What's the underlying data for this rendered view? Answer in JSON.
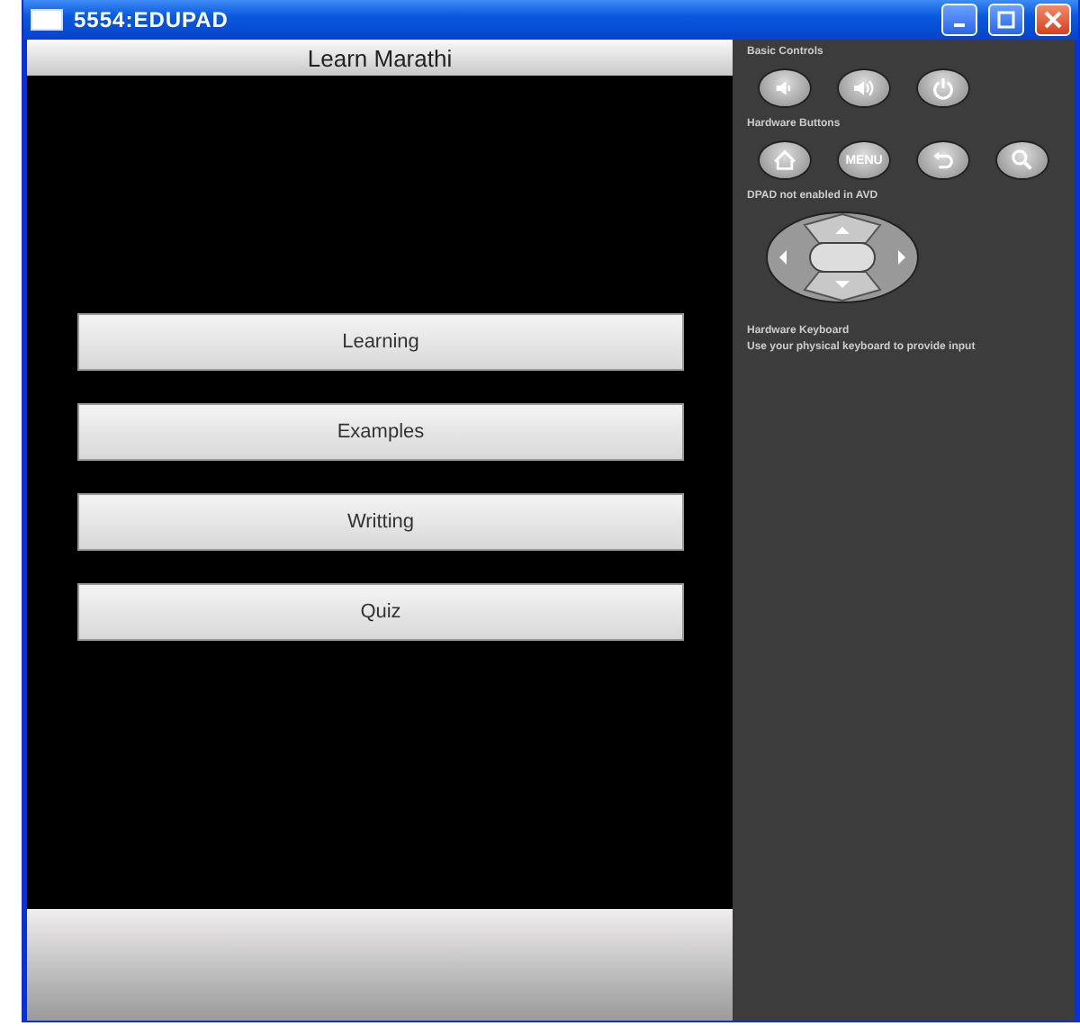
{
  "window": {
    "title": "5554:EDUPAD"
  },
  "app": {
    "title": "Learn Marathi",
    "buttons": [
      "Learning",
      "Examples",
      "Writting",
      "Quiz"
    ]
  },
  "controls": {
    "basic_title": "Basic Controls",
    "basic_buttons": [
      {
        "kind": "volume-down"
      },
      {
        "kind": "volume-up"
      },
      {
        "kind": "power"
      }
    ],
    "hardware_title": "Hardware Buttons",
    "hardware_buttons": [
      {
        "kind": "home"
      },
      {
        "kind": "menu",
        "label": "MENU"
      },
      {
        "kind": "back"
      },
      {
        "kind": "search"
      }
    ],
    "dpad_title": "DPAD not enabled in AVD",
    "keyboard_title": "Hardware Keyboard",
    "keyboard_text": "Use your physical keyboard to provide input"
  }
}
